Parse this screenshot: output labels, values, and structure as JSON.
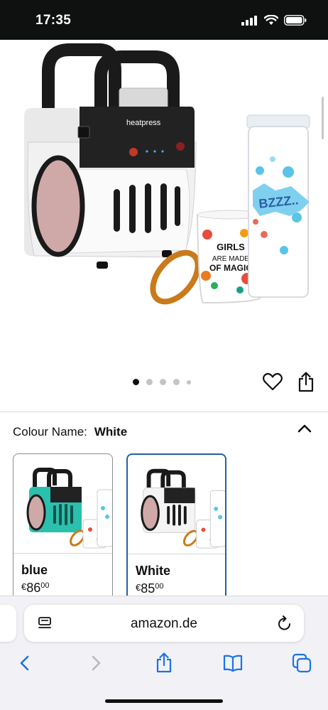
{
  "status_bar": {
    "time": "17:35"
  },
  "product": {
    "brand_on_device": "heatpress",
    "mug_text": "GIRLS ARE MADE OF MAGIC",
    "tumbler_text": "BZZZ..",
    "image_dots": {
      "total": 5,
      "active_index": 0
    }
  },
  "variation": {
    "label": "Colour Name:",
    "selected": "White",
    "options": [
      {
        "name": "blue",
        "currency": "€",
        "price_main": "86",
        "price_fraction": "00",
        "color": "#2bbfae"
      },
      {
        "name": "White",
        "currency": "€",
        "price_main": "85",
        "price_fraction": "00",
        "color": "#f4f4f4"
      }
    ]
  },
  "browser": {
    "url": "amazon.de"
  },
  "colors": {
    "accent_border": "#2162a1",
    "ios_blue": "#1a73e8"
  }
}
